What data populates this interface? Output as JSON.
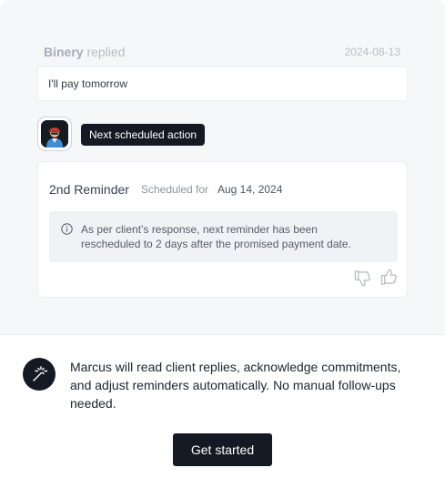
{
  "reply": {
    "sender": "Binery",
    "verb": "replied",
    "date": "2024-08-13",
    "message": "I'll pay tomorrow"
  },
  "next_action": {
    "avatar_icon": "agent-avatar-icon",
    "label": "Next scheduled action"
  },
  "schedule": {
    "title": "2nd Reminder",
    "scheduled_label": "Scheduled for",
    "scheduled_date": "Aug 14, 2024",
    "info_icon": "info-icon",
    "info_line1": "As per client’s response, next reminder  has been",
    "info_line2": "rescheduled to 2 days after the promised payment date."
  },
  "feedback": {
    "thumbs_down_icon": "thumbs-down-icon",
    "thumbs_up_icon": "thumbs-up-icon"
  },
  "footer": {
    "icon": "magic-wand-icon",
    "description": "Marcus will read client replies, acknowledge commitments, and adjust reminders automatically. No manual follow-ups needed.",
    "cta_label": "Get started"
  },
  "colors": {
    "dark": "#141923",
    "panel": "#f6f7f9",
    "info_bg": "#f1f2f5",
    "muted_text": "#a8adb6"
  }
}
